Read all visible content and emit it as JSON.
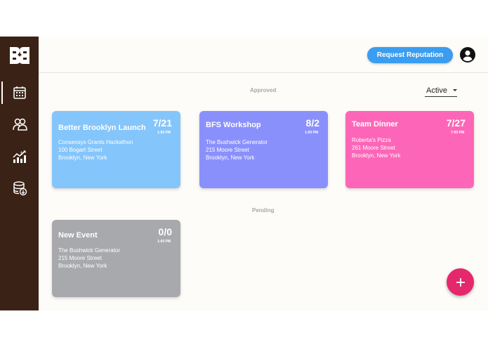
{
  "sidebar": {
    "logo": "bb-logo",
    "items": [
      {
        "icon": "calendar-icon",
        "active": true
      },
      {
        "icon": "users-icon",
        "active": false
      },
      {
        "icon": "growth-chart-icon",
        "active": false
      },
      {
        "icon": "database-download-icon",
        "active": false
      }
    ]
  },
  "header": {
    "request_button_label": "Request Reputation",
    "account_icon": "account-circle-icon"
  },
  "sections": {
    "approved_label": "Approved",
    "pending_label": "Pending"
  },
  "filter": {
    "value": "Active"
  },
  "approved_events": [
    {
      "title": "Better Brooklyn Launch",
      "date": "7/21",
      "time": "1:00 PM",
      "lines": [
        "Consensys Grants Hackathon",
        "100 Bogart Street",
        "Brooklyn, New York"
      ],
      "color": "#84c5fb"
    },
    {
      "title": "BFS Workshop",
      "date": "8/2",
      "time": "1:00 PM",
      "lines": [
        "The Bushwick Generator",
        "215 Moore Street",
        "Brooklyn, New York"
      ],
      "color": "#8a90fb"
    },
    {
      "title": "Team Dinner",
      "date": "7/27",
      "time": "7:00 PM",
      "lines": [
        "Roberta's Pizza",
        "261 Moore Street",
        "Brooklyn, New York"
      ],
      "color": "#fd66b8"
    }
  ],
  "pending_events": [
    {
      "title": "New Event",
      "date": "0/0",
      "time": "1:00 PM",
      "lines": [
        "The Bushwick Generator",
        "215 Moore Street",
        "Brooklyn, New York"
      ],
      "color": "#a8a9ad"
    }
  ],
  "fab": {
    "icon": "plus-icon",
    "color": "#e5276b"
  }
}
